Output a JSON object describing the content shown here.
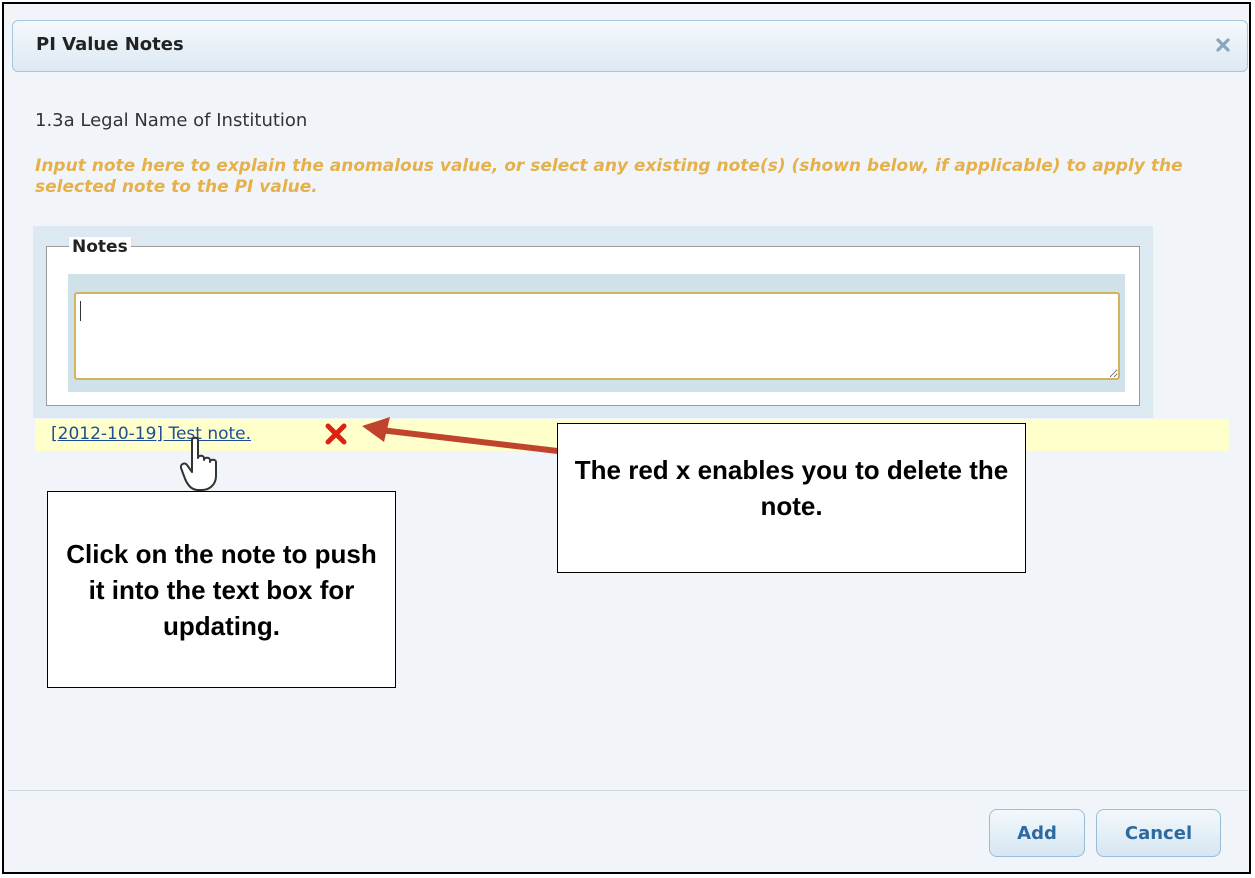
{
  "dialog": {
    "title": "PI Value Notes",
    "close_icon": "close-icon"
  },
  "field": {
    "label": "1.3a Legal Name of Institution",
    "hint": "Input note here to explain the anomalous value, or select any existing note(s) (shown below, if applicable) to apply the selected note to the PI value."
  },
  "notes": {
    "legend": "Notes",
    "value": ""
  },
  "saved_notes": [
    {
      "text": "[2012-10-19] Test note.",
      "delete_icon": "red-x-icon"
    }
  ],
  "callouts": {
    "delete": "The red x enables you to delete the note.",
    "click": "Click on the note to push it into the text box for updating."
  },
  "buttons": {
    "add": "Add",
    "cancel": "Cancel"
  },
  "colors": {
    "hint": "#e6b04a",
    "delete_x": "#dd2211",
    "arrow": "#c0442c",
    "link": "#1f4e96",
    "button_text": "#2c6aa0"
  }
}
